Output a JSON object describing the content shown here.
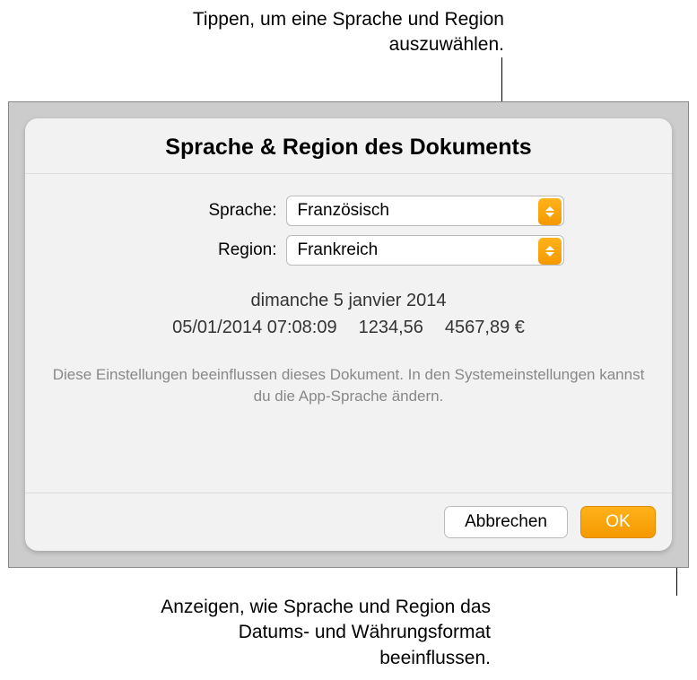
{
  "callouts": {
    "top": "Tippen, um eine Sprache und Region auszuwählen.",
    "bottom": "Anzeigen, wie Sprache und Region das Datums- und Währungsformat beeinflussen."
  },
  "dialog": {
    "title": "Sprache & Region des Dokuments",
    "fields": {
      "language_label": "Sprache:",
      "language_value": "Französisch",
      "region_label": "Region:",
      "region_value": "Frankreich"
    },
    "preview": {
      "date_long": "dimanche 5 janvier 2014",
      "date_time": "05/01/2014 07:08:09",
      "number": "1234,56",
      "currency": "4567,89 €"
    },
    "info": "Diese Einstellungen beeinflussen dieses Dokument. In den Systemeinstellungen kannst du die App-Sprache ändern.",
    "buttons": {
      "cancel": "Abbrechen",
      "ok": "OK"
    }
  }
}
